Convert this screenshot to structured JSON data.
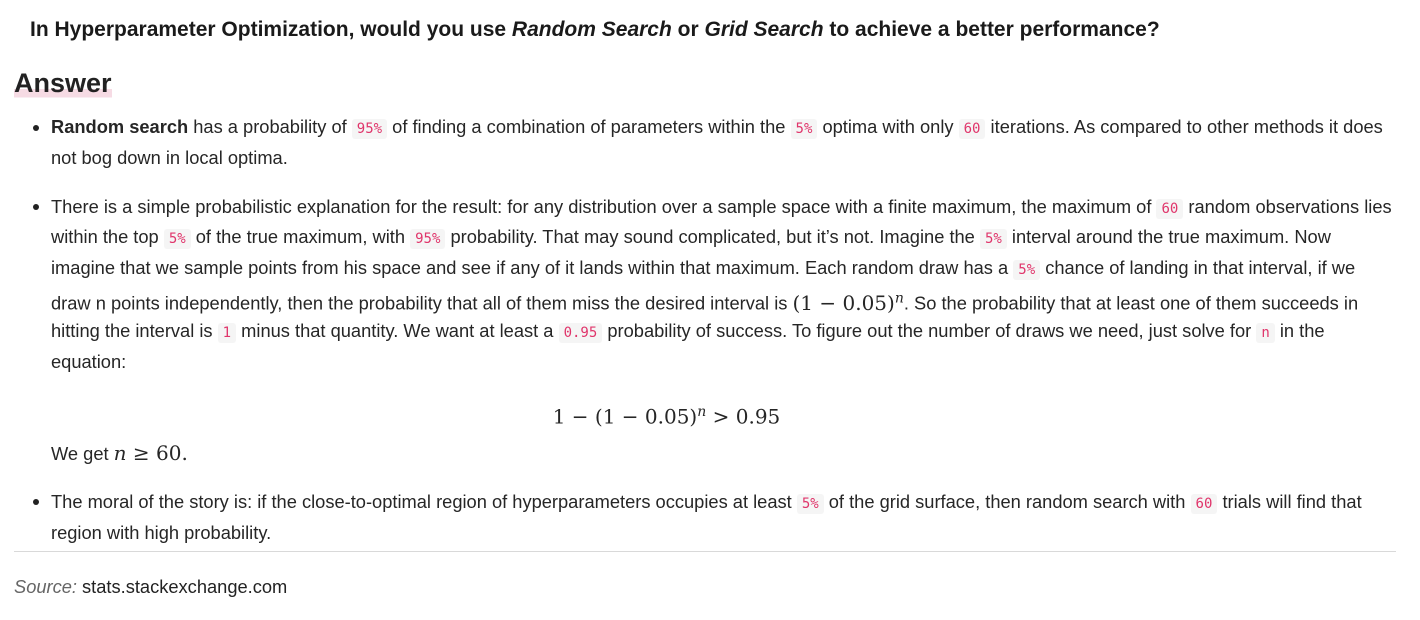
{
  "question": {
    "part1": "In Hyperparameter Optimization, would you use ",
    "option1": "Random Search",
    "part2": " or ",
    "option2": "Grid Search",
    "part3": " to achieve a better performance?"
  },
  "answer_heading": "Answer",
  "answers": [
    {
      "bold": "Random search",
      "t1": " has a probability of ",
      "c1": "95%",
      "t2": " of finding a combination of parameters within the ",
      "c2": "5%",
      "t3": " optima with only ",
      "c3": "60",
      "t4": " iterations. As compared to other methods it does not bog down in local optima."
    },
    {
      "t1": "There is a simple probabilistic explanation for the result: for any distribution over a sample space with a finite maximum, the maximum of ",
      "c1": "60",
      "t2": " random observations lies within the top ",
      "c2": "5%",
      "t3": " of the true maximum, with ",
      "c3": "95%",
      "t4": " probability. That may sound complicated, but it’s not. Imagine the ",
      "c4": "5%",
      "t5": " interval around the true maximum. Now imagine that we sample points from his space and see if any of it lands within that maximum. Each random draw has a ",
      "c5": "5%",
      "t6": " chance of landing in that interval, if we draw n points independently, then the probability that all of them miss the desired interval is ",
      "m1_base": "(1 − 0.05)",
      "m1_exp": "n",
      "t7": ". So the probability that at least one of them succeeds in hitting the interval is ",
      "c6": "1",
      "t8": " minus that quantity. We want at least a ",
      "c7": "0.95",
      "t9": " probability of success. To figure out the number of draws we need, just solve for ",
      "c8": "n",
      "t10": " in the equation:",
      "display_left": "1 − (1 − 0.05)",
      "display_exp": "n",
      "display_right": " > 0.95",
      "we_get_text": "We get ",
      "we_get_var": "n",
      "we_get_rest": " ≥ 60."
    },
    {
      "t1": "The moral of the story is: if the close-to-optimal region of hyperparameters occupies at least ",
      "c1": "5%",
      "t2": " of the grid surface, then random search with ",
      "c2": "60",
      "t3": " trials will find that region with high probability."
    }
  ],
  "source": {
    "label": "Source:",
    "site": "stats.stackexchange.com"
  }
}
